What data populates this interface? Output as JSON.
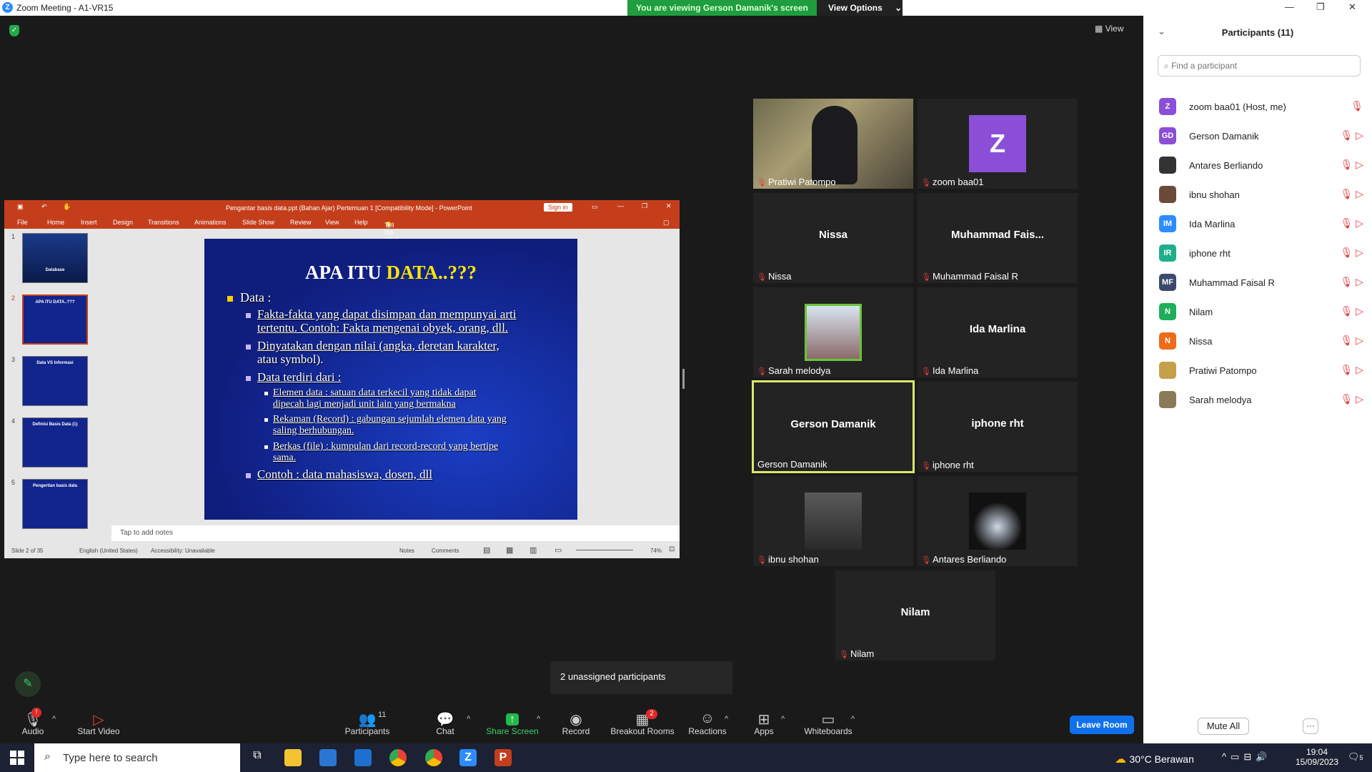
{
  "window": {
    "title": "Zoom Meeting - A1-VR15"
  },
  "banner": {
    "text": "You are viewing Gerson Damanik's screen",
    "view_options": "View Options"
  },
  "view_button": "View",
  "ppt": {
    "title": "Pengantar basis data.ppt (Bahan Ajar) Pertemuan 1 [Compatibility Mode]  -  PowerPoint",
    "sign_in": "Sign in",
    "menu": [
      "File",
      "Home",
      "Insert",
      "Design",
      "Transitions",
      "Animations",
      "Slide Show",
      "Review",
      "View",
      "Help",
      "Tell me what you want to do"
    ],
    "thumbnails": [
      {
        "num": "1",
        "label": "Database"
      },
      {
        "num": "2",
        "label": "APA ITU DATA..???"
      },
      {
        "num": "3",
        "label": "Data VS Informasi"
      },
      {
        "num": "4",
        "label": "Definisi Basis Data (1)"
      },
      {
        "num": "5",
        "label": "Pengertian basis data"
      }
    ],
    "slide": {
      "title_part1": "APA ITU ",
      "title_part2": "DATA..???",
      "b1": "Data :",
      "b2a": "Fakta-fakta yang dapat disimpan dan mempunyai arti",
      "b2b": "tertentu. Contoh: Fakta mengenai obyek, orang, dll.",
      "b3a": "Dinyatakan dengan nilai (angka, deretan karakter,",
      "b3b": "atau symbol).",
      "b4": "Data terdiri dari :",
      "b5a": "Elemen data : satuan data terkecil yang tidak dapat",
      "b5b": "dipecah lagi menjadi unit lain yang bermakna",
      "b6a": "Rekaman (Record) : gabungan sejumlah elemen data yang",
      "b6b": "saling berhubungan.",
      "b7a": "Berkas (file) : kumpulan dari record-record yang bertipe",
      "b7b": "sama.",
      "b8": "Contoh : data mahasiswa, dosen, dll"
    },
    "notes_placeholder": "Tap to add notes",
    "status": {
      "slide": "Slide 2 of 35",
      "lang": "English (United States)",
      "access": "Accessibility: Unavailable",
      "notes": "Notes",
      "comments": "Comments",
      "zoom": "74%"
    }
  },
  "tiles": [
    {
      "name": "Pratiwi Patompo",
      "center": "",
      "muted": true
    },
    {
      "name": "zoom baa01",
      "center": "",
      "muted": true,
      "letter": "Z"
    },
    {
      "name": "Nissa",
      "center": "Nissa",
      "muted": true
    },
    {
      "name": "Muhammad Faisal R",
      "center": "Muhammad  Fais...",
      "muted": true
    },
    {
      "name": "Sarah melodya",
      "center": "",
      "muted": true
    },
    {
      "name": "Ida Marlina",
      "center": "Ida Marlina",
      "muted": true
    },
    {
      "name": "Gerson Damanik",
      "center": "Gerson Damanik",
      "muted": false
    },
    {
      "name": "iphone rht",
      "center": "iphone rht",
      "muted": true
    },
    {
      "name": "ibnu shohan",
      "center": "",
      "muted": true
    },
    {
      "name": "Antares Berliando",
      "center": "",
      "muted": true
    },
    {
      "name": "Nilam",
      "center": "Nilam",
      "muted": true
    }
  ],
  "panel": {
    "title": "Participants (11)",
    "search_placeholder": "Find a participant",
    "participants": [
      {
        "initials": "Z",
        "name": "zoom baa01 (Host, me)",
        "color": "#8a4fd6"
      },
      {
        "initials": "GD",
        "name": "Gerson Damanik",
        "color": "#8a4fd6"
      },
      {
        "initials": "",
        "name": "Antares Berliando",
        "color": "#333333"
      },
      {
        "initials": "",
        "name": "ibnu shohan",
        "color": "#6b4a3a"
      },
      {
        "initials": "IM",
        "name": "Ida Marlina",
        "color": "#2d8cff"
      },
      {
        "initials": "IR",
        "name": "iphone rht",
        "color": "#1fae8a"
      },
      {
        "initials": "MF",
        "name": "Muhammad Faisal R",
        "color": "#3b4a6b"
      },
      {
        "initials": "N",
        "name": "Nilam",
        "color": "#1fae5a"
      },
      {
        "initials": "N",
        "name": "Nissa",
        "color": "#f06a1a"
      },
      {
        "initials": "",
        "name": "Pratiwi Patompo",
        "color": "#c4a04a"
      },
      {
        "initials": "",
        "name": "Sarah melodya",
        "color": "#8a7a5a"
      }
    ],
    "mute_all": "Mute All",
    "more": "···"
  },
  "toolbar": {
    "audio": "Audio",
    "start_video": "Start Video",
    "participants": "Participants",
    "participants_count": "11",
    "chat": "Chat",
    "share": "Share Screen",
    "record": "Record",
    "breakout": "Breakout Rooms",
    "breakout_badge": "2",
    "reactions": "Reactions",
    "apps": "Apps",
    "whiteboards": "Whiteboards",
    "leave": "Leave Room",
    "audio_badge": "!"
  },
  "tooltip": "2 unassigned participants",
  "taskbar": {
    "search": "Type here to search",
    "weather": "30°C  Berawan",
    "time": "19:04",
    "date": "15/09/2023",
    "notif": "5"
  }
}
